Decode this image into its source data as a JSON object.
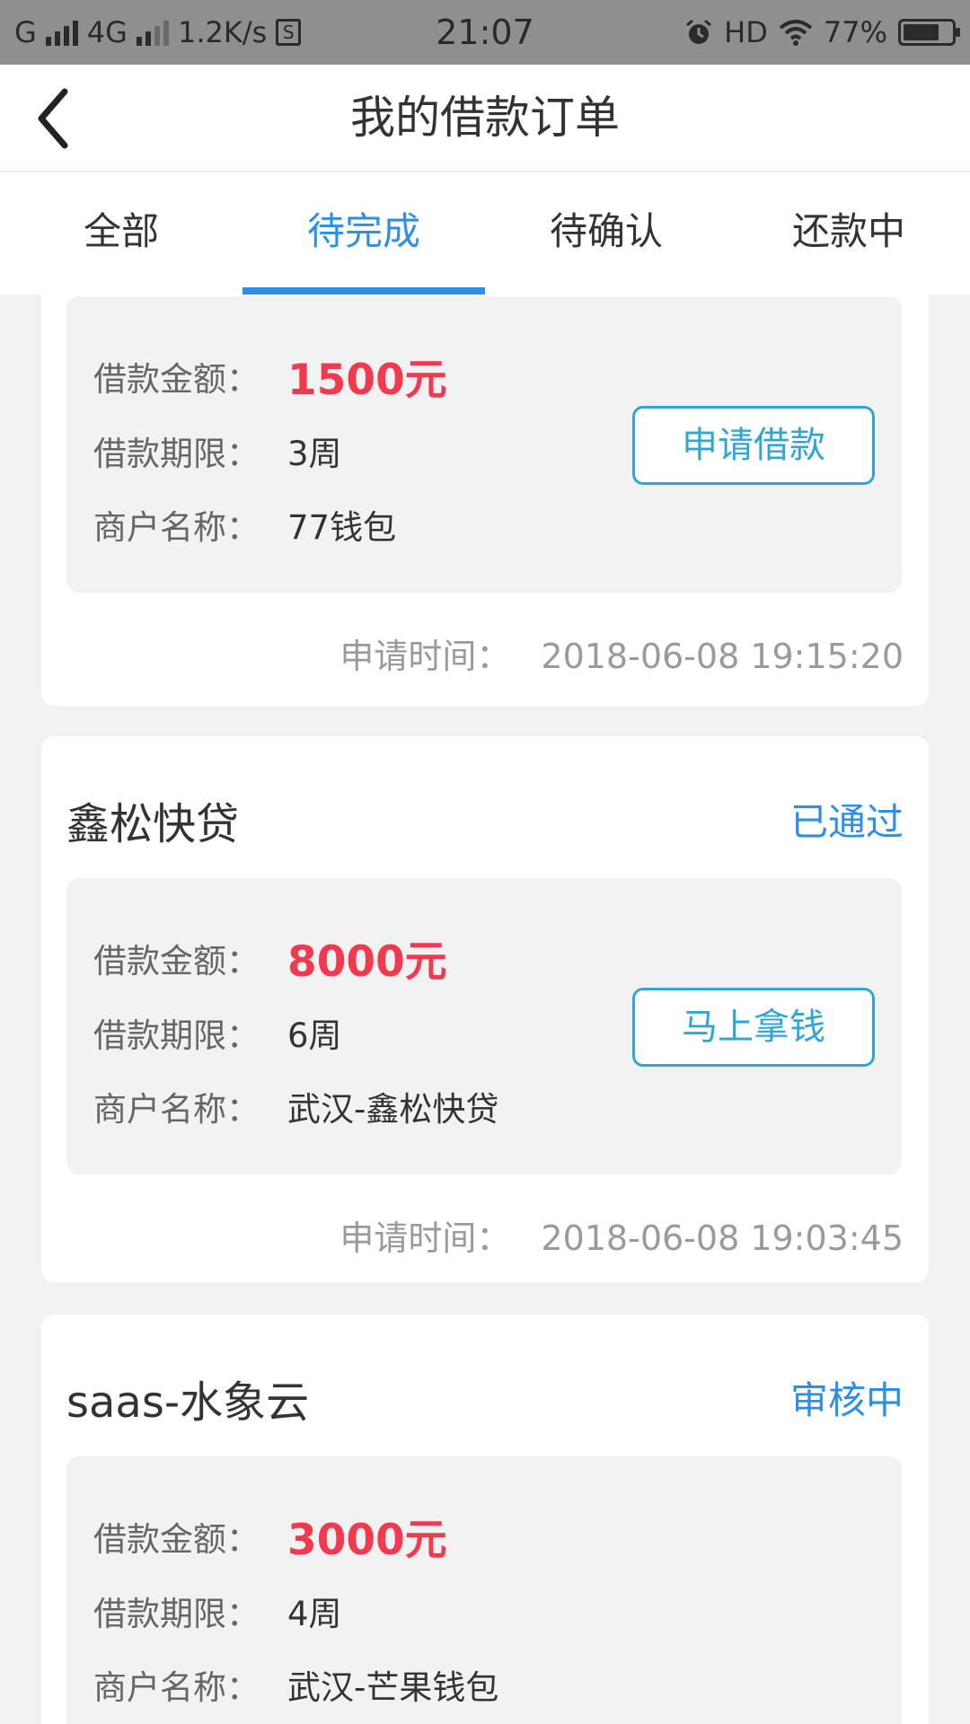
{
  "status_bar": {
    "carrier_1": "G",
    "carrier_2": "4G",
    "speed": "1.2K/s",
    "time": "21:07",
    "hd": "HD",
    "battery": "77%",
    "battery_level": 0.77
  },
  "header": {
    "title": "我的借款订单",
    "back_icon": "chevron-left-icon"
  },
  "tabs": [
    {
      "label": "全部",
      "active": false
    },
    {
      "label": "待完成",
      "active": true
    },
    {
      "label": "待确认",
      "active": false
    },
    {
      "label": "还款中",
      "active": false
    }
  ],
  "labels": {
    "amount": "借款金额：",
    "term": "借款期限：",
    "merchant": "商户名称：",
    "apply_time": "申请时间："
  },
  "orders": [
    {
      "name": "",
      "status": "",
      "amount": "1500元",
      "term": "3周",
      "merchant": "77钱包",
      "button": "申请借款",
      "apply_time": "2018-06-08 19:15:20"
    },
    {
      "name": "鑫松快贷",
      "status": "已通过",
      "amount": "8000元",
      "term": "6周",
      "merchant": "武汉-鑫松快贷",
      "button": "马上拿钱",
      "apply_time": "2018-06-08 19:03:45"
    },
    {
      "name": "saas-水象云",
      "status": "审核中",
      "amount": "3000元",
      "term": "4周",
      "merchant": "武汉-芒果钱包"
    }
  ],
  "colors": {
    "accent": "#2e8fe8",
    "amount": "#f03a4f",
    "button": "#2fa6d6",
    "background": "#f2f2f2"
  }
}
